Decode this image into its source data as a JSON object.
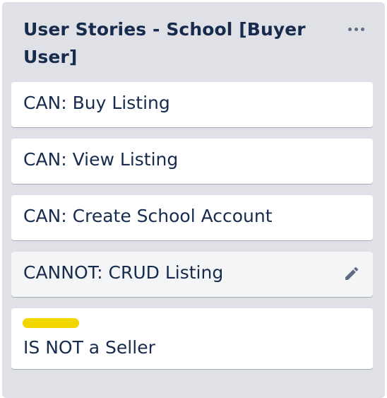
{
  "list": {
    "title": "User Stories - School [Buyer User]",
    "menu_icon": "more-horizontal-icon"
  },
  "cards": [
    {
      "title": "CAN: Buy Listing"
    },
    {
      "title": "CAN: View Listing"
    },
    {
      "title": "CAN: Create School Account"
    },
    {
      "title": "CANNOT: CRUD Listing",
      "hovered": true,
      "action_icon": "pencil-edit-icon"
    },
    {
      "title": "IS NOT a Seller",
      "label_color": "#f2d600"
    }
  ],
  "colors": {
    "list_background": "#dfe1e6",
    "card_background": "#ffffff",
    "card_hover_background": "#f4f5f7",
    "text": "#172b4d",
    "icon": "#5e6c84",
    "label_yellow": "#f2d600"
  }
}
